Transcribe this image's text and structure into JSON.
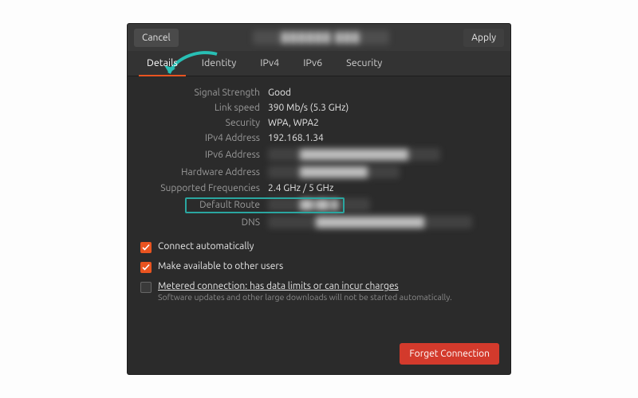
{
  "header": {
    "cancel": "Cancel",
    "apply": "Apply",
    "title_redacted": "██████ ███"
  },
  "tabs": [
    "Details",
    "Identity",
    "IPv4",
    "IPv6",
    "Security"
  ],
  "active_tab_index": 0,
  "details": {
    "rows": [
      {
        "label": "Signal Strength",
        "value": "Good",
        "redacted": false
      },
      {
        "label": "Link speed",
        "value": "390 Mb/s (5.3 GHz)",
        "redacted": false
      },
      {
        "label": "Security",
        "value": "WPA, WPA2",
        "redacted": false
      },
      {
        "label": "IPv4 Address",
        "value": "192.168.1.34",
        "redacted": false
      },
      {
        "label": "IPv6 Address",
        "value": "████████████████",
        "redacted": true
      },
      {
        "label": "Hardware Address",
        "value": "██████████",
        "redacted": true
      },
      {
        "label": "Supported Frequencies",
        "value": "2.4 GHz / 5 GHz",
        "redacted": false
      },
      {
        "label": "Default Route",
        "value": "██ ██ █",
        "redacted": true,
        "highlighted": true
      },
      {
        "label": "DNS",
        "value": "████████████████",
        "redacted": true
      }
    ]
  },
  "checkboxes": {
    "auto": {
      "label": "Connect automatically",
      "checked": true
    },
    "share": {
      "label": "Make available to other users",
      "checked": true
    },
    "metered": {
      "label": "Metered connection: has data limits or can incur charges",
      "sub": "Software updates and other large downloads will not be started automatically.",
      "checked": false
    }
  },
  "footer": {
    "forget": "Forget Connection"
  },
  "colors": {
    "accent": "#e95420",
    "highlight": "#2aa6a0",
    "danger": "#d33a2c",
    "arrow": "#28bfb4"
  }
}
